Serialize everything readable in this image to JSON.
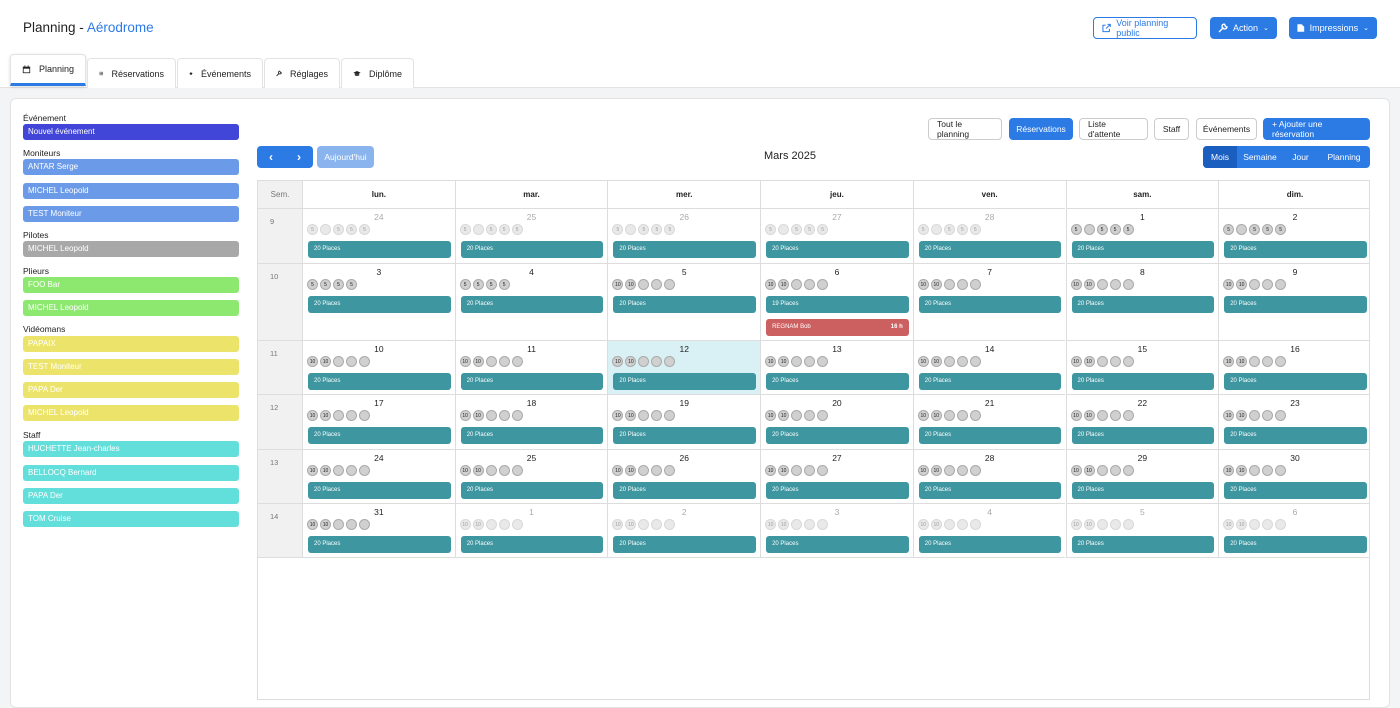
{
  "header": {
    "title": "Planning",
    "separator": " - ",
    "subtitle": "Aérodrome",
    "public_btn": "Voir planning public",
    "action_btn": "Action",
    "print_btn": "Impressions"
  },
  "tabs": [
    "Planning",
    "Réservations",
    "Événements",
    "Réglages",
    "Diplôme"
  ],
  "sidebar": {
    "groups": [
      {
        "title": "Événement",
        "items": [
          {
            "label": "Nouvel événement",
            "color": "#4146d8"
          }
        ]
      },
      {
        "title": "Moniteurs",
        "items": [
          {
            "label": "ANTAR Serge",
            "color": "#6b9ae8"
          },
          {
            "label": "MICHEL Leopold",
            "color": "#6b9ae8"
          },
          {
            "label": "TEST Moniteur",
            "color": "#6b9ae8"
          }
        ]
      },
      {
        "title": "Pilotes",
        "items": [
          {
            "label": "MICHEL Leopold",
            "color": "#a8a8a8"
          }
        ]
      },
      {
        "title": "Plieurs",
        "items": [
          {
            "label": "FOO Bar",
            "color": "#8de870"
          },
          {
            "label": "MICHEL Leopold",
            "color": "#8de870"
          }
        ]
      },
      {
        "title": "Vidéomans",
        "items": [
          {
            "label": "PAPAIX",
            "color": "#ece46a"
          },
          {
            "label": "TEST Moniteur",
            "color": "#ece46a"
          },
          {
            "label": "PAPA Der",
            "color": "#ece46a"
          },
          {
            "label": "MICHEL Leopold",
            "color": "#ece46a"
          }
        ]
      },
      {
        "title": "Staff",
        "items": [
          {
            "label": "HUCHETTE Jean-charles",
            "color": "#62dedb"
          },
          {
            "label": "BELLOCQ Bernard",
            "color": "#62dedb"
          },
          {
            "label": "PAPA Der",
            "color": "#62dedb"
          },
          {
            "label": "TOM Cruise",
            "color": "#62dedb"
          }
        ]
      }
    ]
  },
  "filters": [
    "Tout le planning",
    "Réservations",
    "Liste d'attente",
    "Staff",
    "Événements",
    "+ Ajouter une réservation"
  ],
  "calendar": {
    "today_btn": "Aujourd'hui",
    "month": "Mars 2025",
    "views": [
      "Mois",
      "Semaine",
      "Jour",
      "Planning"
    ],
    "week_label": "Sem.",
    "days": [
      "lun.",
      "mar.",
      "mer.",
      "jeu.",
      "ven.",
      "sam.",
      "dim."
    ],
    "weeks": [
      {
        "num": "9",
        "dates": [
          "24",
          "25",
          "26",
          "27",
          "28",
          "1",
          "2"
        ],
        "dim": [
          1,
          1,
          1,
          1,
          1,
          0,
          0
        ],
        "avatars": [
          "5",
          "5",
          "5",
          "5"
        ],
        "bars": [
          "20 Places",
          "20 Places",
          "20 Places",
          "20 Places",
          "20 Places",
          "20 Places",
          "20 Places"
        ]
      },
      {
        "num": "10",
        "dates": [
          "3",
          "4",
          "5",
          "6",
          "7",
          "8",
          "9"
        ],
        "dim": [
          0,
          0,
          0,
          0,
          0,
          0,
          0
        ],
        "avatars": [],
        "bars": [
          "20 Places",
          "20 Places",
          "20 Places",
          "19 Places",
          "20 Places",
          "20 Places",
          "20 Places"
        ]
      },
      {
        "num": "11",
        "dates": [
          "10",
          "11",
          "12",
          "13",
          "14",
          "15",
          "16"
        ],
        "dim": [
          0,
          0,
          0,
          0,
          0,
          0,
          0
        ],
        "avatars": [
          "10",
          "10"
        ],
        "bars": [
          "20 Places",
          "20 Places",
          "20 Places",
          "20 Places",
          "20 Places",
          "20 Places",
          "20 Places"
        ]
      },
      {
        "num": "12",
        "dates": [
          "17",
          "18",
          "19",
          "20",
          "21",
          "22",
          "23"
        ],
        "dim": [
          0,
          0,
          0,
          0,
          0,
          0,
          0
        ],
        "avatars": [
          "10",
          "10"
        ],
        "bars": [
          "20 Places",
          "20 Places",
          "20 Places",
          "20 Places",
          "20 Places",
          "20 Places",
          "20 Places"
        ]
      },
      {
        "num": "13",
        "dates": [
          "24",
          "25",
          "26",
          "27",
          "28",
          "29",
          "30"
        ],
        "dim": [
          0,
          0,
          0,
          0,
          0,
          0,
          0
        ],
        "avatars": [
          "10",
          "10"
        ],
        "bars": [
          "20 Places",
          "20 Places",
          "20 Places",
          "20 Places",
          "20 Places",
          "20 Places",
          "20 Places"
        ]
      },
      {
        "num": "14",
        "dates": [
          "31",
          "1",
          "2",
          "3",
          "4",
          "5",
          "6"
        ],
        "dim": [
          0,
          1,
          1,
          1,
          1,
          1,
          1
        ],
        "avatars": [
          "10",
          "10"
        ],
        "bars": [
          "20 Places",
          "20 Places",
          "20 Places",
          "20 Places",
          "20 Places",
          "20 Places",
          "20 Places"
        ]
      }
    ],
    "event": {
      "label": "REGNAM Bob",
      "time": "16 h",
      "color": "#cc5f5f"
    }
  }
}
